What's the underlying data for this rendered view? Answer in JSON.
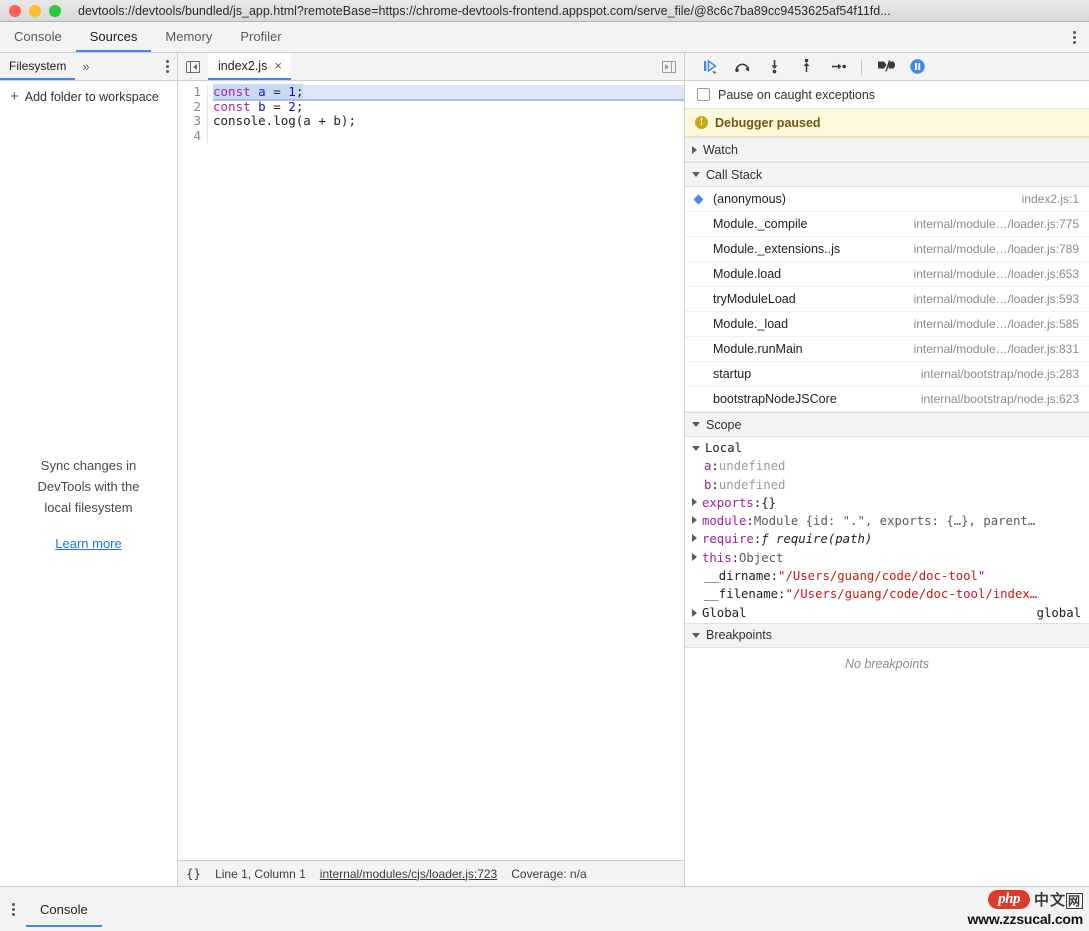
{
  "window": {
    "title": "devtools://devtools/bundled/js_app.html?remoteBase=https://chrome-devtools-frontend.appspot.com/serve_file/@8c6c7ba89cc9453625af54f11fd..."
  },
  "devtools_tabs": [
    {
      "label": "Console",
      "active": false
    },
    {
      "label": "Sources",
      "active": true
    },
    {
      "label": "Memory",
      "active": false
    },
    {
      "label": "Profiler",
      "active": false
    }
  ],
  "navigator": {
    "tab_label": "Filesystem",
    "more_glyph": "»",
    "add_folder_label": "Add folder to workspace",
    "add_folder_plus": "+",
    "hint_text": "Sync changes in DevTools with the local filesystem",
    "learn_more_label": "Learn more"
  },
  "editor": {
    "tab_name": "index2.js",
    "close_glyph": "×",
    "line_numbers": [
      "1",
      "2",
      "3",
      "4"
    ],
    "code": {
      "line1": {
        "kw": "const",
        "var": "a",
        "eq": "=",
        "num": "1",
        "semi": ";"
      },
      "line2": {
        "kw": "const",
        "var": "b",
        "eq": "=",
        "num": "2",
        "semi": ";"
      },
      "line3": {
        "text": "console.log(a + b);"
      },
      "line4": {
        "text": ""
      }
    },
    "status": {
      "braces": "{}",
      "position": "Line 1, Column 1",
      "link": "internal/modules/cjs/loader.js:723",
      "coverage": "Coverage: n/a"
    }
  },
  "debugger": {
    "toolbar_icons": [
      "resume-script-execution-icon",
      "step-over-next-function-call-icon",
      "step-into-next-function-call-icon",
      "step-out-of-current-function-icon",
      "step-icon",
      "deactivate-breakpoints-icon",
      "pause-on-exceptions-icon"
    ],
    "pause_on_caught_label": "Pause on caught exceptions",
    "paused_banner": "Debugger paused",
    "sections": {
      "watch": "Watch",
      "call_stack": "Call Stack",
      "scope": "Scope",
      "breakpoints": "Breakpoints"
    },
    "call_stack": [
      {
        "name": "(anonymous)",
        "location": "index2.js:1",
        "selected": true
      },
      {
        "name": "Module._compile",
        "location": "internal/module…/loader.js:775",
        "selected": false
      },
      {
        "name": "Module._extensions..js",
        "location": "internal/module…/loader.js:789",
        "selected": false
      },
      {
        "name": "Module.load",
        "location": "internal/module…/loader.js:653",
        "selected": false
      },
      {
        "name": "tryModuleLoad",
        "location": "internal/module…/loader.js:593",
        "selected": false
      },
      {
        "name": "Module._load",
        "location": "internal/module…/loader.js:585",
        "selected": false
      },
      {
        "name": "Module.runMain",
        "location": "internal/module…/loader.js:831",
        "selected": false
      },
      {
        "name": "startup",
        "location": "internal/bootstrap/node.js:283",
        "selected": false
      },
      {
        "name": "bootstrapNodeJSCore",
        "location": "internal/bootstrap/node.js:623",
        "selected": false
      }
    ],
    "scope": {
      "local_label": "Local",
      "entries": [
        {
          "prop": "a",
          "sep": ": ",
          "value": "undefined",
          "value_kind": "undef",
          "expandable": false,
          "indent": true
        },
        {
          "prop": "b",
          "sep": ": ",
          "value": "undefined",
          "value_kind": "undef",
          "expandable": false,
          "indent": true
        },
        {
          "prop": "exports",
          "sep": ": ",
          "value": "{}",
          "value_kind": "plain",
          "expandable": true,
          "indent": false
        },
        {
          "prop": "module",
          "sep": ": ",
          "value": "Module {id: \".\", exports: {…}, parent…",
          "value_kind": "obj",
          "expandable": true,
          "indent": false
        },
        {
          "prop": "require",
          "sep": ": ",
          "value": "ƒ require(path)",
          "value_kind": "fn",
          "expandable": true,
          "indent": false
        },
        {
          "prop": "this",
          "sep": ": ",
          "value": "Object",
          "value_kind": "obj",
          "expandable": true,
          "indent": false
        },
        {
          "prop": "__dirname",
          "sep": ": ",
          "value": "\"/Users/guang/code/doc-tool\"",
          "value_kind": "str",
          "expandable": false,
          "indent": true
        },
        {
          "prop": "__filename",
          "sep": ": ",
          "value": "\"/Users/guang/code/doc-tool/index…",
          "value_kind": "str",
          "expandable": false,
          "indent": true
        }
      ],
      "global_label": "Global",
      "global_value": "global"
    },
    "no_breakpoints": "No breakpoints"
  },
  "drawer": {
    "tab_label": "Console"
  },
  "watermark": {
    "badge": "php",
    "cn": "中文",
    "cn_box": "网",
    "url": "www.zzsucal.com"
  },
  "colors": {
    "accent": "#4285f4",
    "banner_bg": "#fdf8d9",
    "link": "#1a73e8",
    "string": "#c41a16",
    "property": "#a020a0"
  }
}
